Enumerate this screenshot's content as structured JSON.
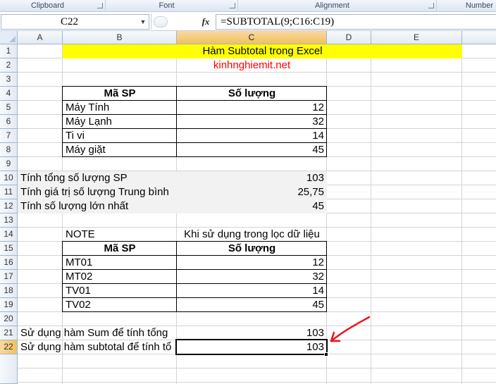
{
  "ribbon": {
    "groups": [
      "Clipboard",
      "Font",
      "Alignment",
      "Number"
    ]
  },
  "formula_bar": {
    "name_box": "C22",
    "fx_label": "fx",
    "formula": "=SUBTOTAL(9;C16:C19)"
  },
  "columns": [
    "A",
    "B",
    "C",
    "D",
    "E"
  ],
  "rows": [
    "1",
    "2",
    "3",
    "4",
    "5",
    "6",
    "7",
    "8",
    "9",
    "10",
    "11",
    "12",
    "13",
    "14",
    "15",
    "16",
    "17",
    "18",
    "19",
    "20",
    "21",
    "22"
  ],
  "sheet": {
    "title": "Hàm Subtotal  trong Excel",
    "website": "kinhnghiemit.net",
    "table1": {
      "header_product": "Mã SP",
      "header_qty": "Số lượng",
      "rows": [
        {
          "product": "Máy Tính",
          "qty": "12"
        },
        {
          "product": "Máy Lạnh",
          "qty": "32"
        },
        {
          "product": "Ti vi",
          "qty": "14"
        },
        {
          "product": "Máy giặt",
          "qty": "45"
        }
      ]
    },
    "calcs": [
      {
        "label": "Tính tổng số lượng SP",
        "value": "103"
      },
      {
        "label": "Tính giá trị số lượng Trung bình",
        "value": "25,75"
      },
      {
        "label": "Tính số lượng lớn nhất",
        "value": "45"
      }
    ],
    "note_label": "NOTE",
    "note_text": "Khi sử dụng trong lọc dữ liệu",
    "table2": {
      "header_product": "Mã SP",
      "header_qty": "Số lượng",
      "rows": [
        {
          "product": "MT01",
          "qty": "12"
        },
        {
          "product": "MT02",
          "qty": "32"
        },
        {
          "product": "TV01",
          "qty": "14"
        },
        {
          "product": "TV02",
          "qty": "45"
        }
      ]
    },
    "sum_label": "Sử dụng hàm Sum để tính tổng",
    "sum_value": "103",
    "subtotal_label": "Sử dụng hàm subtotal để tính tổ",
    "subtotal_value": "103"
  },
  "colors": {
    "title_fill": "#ffff00",
    "website_text": "#ff0000",
    "annotation_arrow": "#e8141b",
    "calc_fill": "#f2f2f2"
  },
  "icons": [
    "name-box-dropdown-icon",
    "formula-bar-handle-icon",
    "insert-function-icon",
    "select-all-icon",
    "red-arrow-annotation"
  ]
}
